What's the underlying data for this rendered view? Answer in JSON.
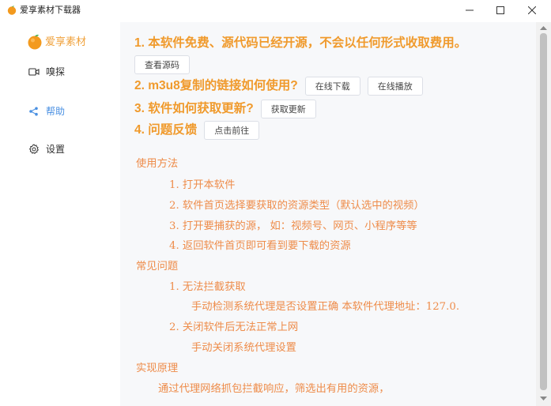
{
  "window": {
    "title": "爱享素材下载器",
    "controls": {
      "minimize": "−",
      "maximize": "☐",
      "close": "✕"
    }
  },
  "sidebar": {
    "brand": "爱享素材",
    "items": [
      {
        "label": "嗅探",
        "icon": "video-camera-icon",
        "active": false
      },
      {
        "label": "帮助",
        "icon": "share-icon",
        "active": true
      },
      {
        "label": "设置",
        "icon": "gear-icon",
        "active": false
      }
    ]
  },
  "help": {
    "q1": {
      "text": "1. 本软件免费、源代码已经开源，不会以任何形式收取费用。",
      "button": "查看源码"
    },
    "q2": {
      "text": "2. m3u8复制的链接如何使用?",
      "button_download": "在线下载",
      "button_play": "在线播放"
    },
    "q3": {
      "text": "3. 软件如何获取更新?",
      "button": "获取更新"
    },
    "q4": {
      "text": "4. 问题反馈",
      "button": "点击前往"
    }
  },
  "doc": {
    "usage_title": "使用方法",
    "usage_steps": [
      "1. 打开本软件",
      "2. 软件首页选择要获取的资源类型（默认选中的视频）",
      "3. 打开要捕获的源， 如：视频号、网页、小程序等等",
      "4. 返回软件首页即可看到要下载的资源"
    ],
    "faq_title": "常见问题",
    "faq_1_q": "1. 无法拦截获取",
    "faq_1_a": "手动检测系统代理是否设置正确 本软件代理地址：127.0.",
    "faq_2_q": "2. 关闭软件后无法正常上网",
    "faq_2_a": "手动关闭系统代理设置",
    "principle_title": "实现原理",
    "principle_text": "通过代理网络抓包拦截响应，筛选出有用的资源，"
  },
  "colors": {
    "accent_orange": "#f09a2c",
    "doc_orange": "#ee8c4a",
    "active_blue": "#4a90e2",
    "content_bg": "#f7f8fa"
  }
}
